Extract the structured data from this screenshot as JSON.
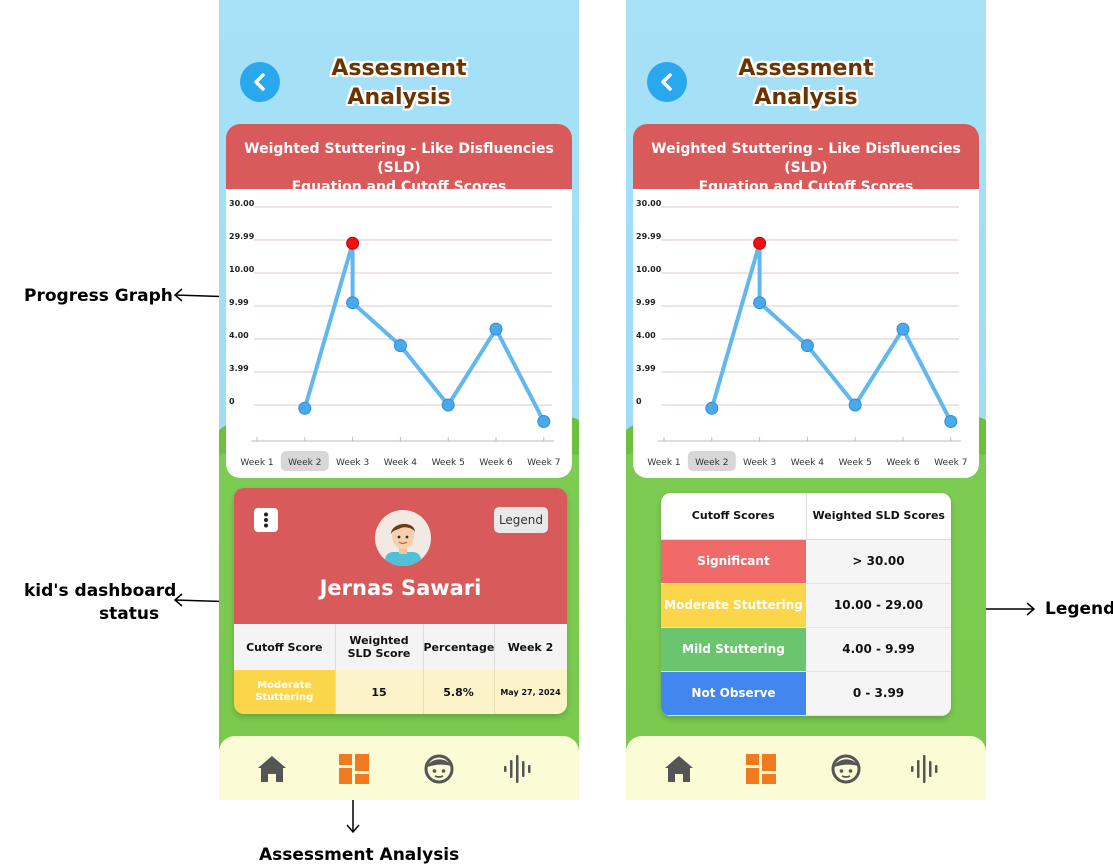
{
  "annotations": {
    "progress_graph": "Progress Graph",
    "dashboard_status_line1": "kid's dashboard",
    "dashboard_status_line2": "status",
    "assessment_analysis": "Assessment Analysis",
    "legend": "Legend"
  },
  "screen": {
    "title_line1": "Assesment",
    "title_line2": "Analysis",
    "chart_title_line1": "Weighted Stuttering - Like Disfluencies (SLD)",
    "chart_title_line2": "Equation and Cutoff Scores"
  },
  "chart_data": {
    "type": "line",
    "categories": [
      "Week 1",
      "Week 2",
      "Week 3",
      "Week 4",
      "Week 5",
      "Week 6",
      "Week 7"
    ],
    "y_tick_labels": [
      "30.00",
      "29.99",
      "10.00",
      "9.99",
      "4.00",
      "3.99",
      "0"
    ],
    "highlighted_category": "Week 2",
    "points": [
      {
        "x": "Week 2",
        "level": -0.1
      },
      {
        "x": "Week 3",
        "level": 4.9,
        "highlight": true
      },
      {
        "x": "Week 3",
        "level": 3.1
      },
      {
        "x": "Week 4",
        "level": 1.8
      },
      {
        "x": "Week 5",
        "level": 0.0
      },
      {
        "x": "Week 6",
        "level": 2.3
      },
      {
        "x": "Week 7",
        "level": -0.5
      }
    ],
    "line_color": "#62b8ee",
    "point_color": "#4aa9ea",
    "highlight_color": "#f01010",
    "grid": true
  },
  "dashboard": {
    "legend_button": "Legend",
    "kid_name": "Jernas Sawari",
    "columns": [
      "Cutoff Score",
      "Weighted SLD Score",
      "Percentage",
      "Week 2"
    ],
    "row": {
      "cutoff": "Moderate Stuttering",
      "score": "15",
      "percentage": "5.8%",
      "date": "May 27, 2024"
    }
  },
  "legend_table": {
    "columns": [
      "Cutoff Scores",
      "Weighted SLD Scores"
    ],
    "rows": [
      {
        "label": "Significant",
        "range": "> 30.00",
        "color": "#f06a6a"
      },
      {
        "label": "Moderate Stuttering",
        "range": "10.00 - 29.00",
        "color": "#fbd64b"
      },
      {
        "label": "Mild Stuttering",
        "range": "4.00 - 9.99",
        "color": "#6bc56f"
      },
      {
        "label": "Not Observe",
        "range": "0 - 3.99",
        "color": "#4286f0"
      }
    ]
  },
  "nav_icons": [
    "home-icon",
    "dashboard-icon",
    "kid-face-icon",
    "voice-wave-icon"
  ],
  "colors": {
    "sky": "#a6e1f7",
    "grass": "#7ccb52",
    "header_red": "#d95a5a",
    "title_brown": "#6b3300",
    "nav_bg": "#fbfbd6",
    "nav_icon": "#555555",
    "nav_active": "#f07a1e"
  }
}
